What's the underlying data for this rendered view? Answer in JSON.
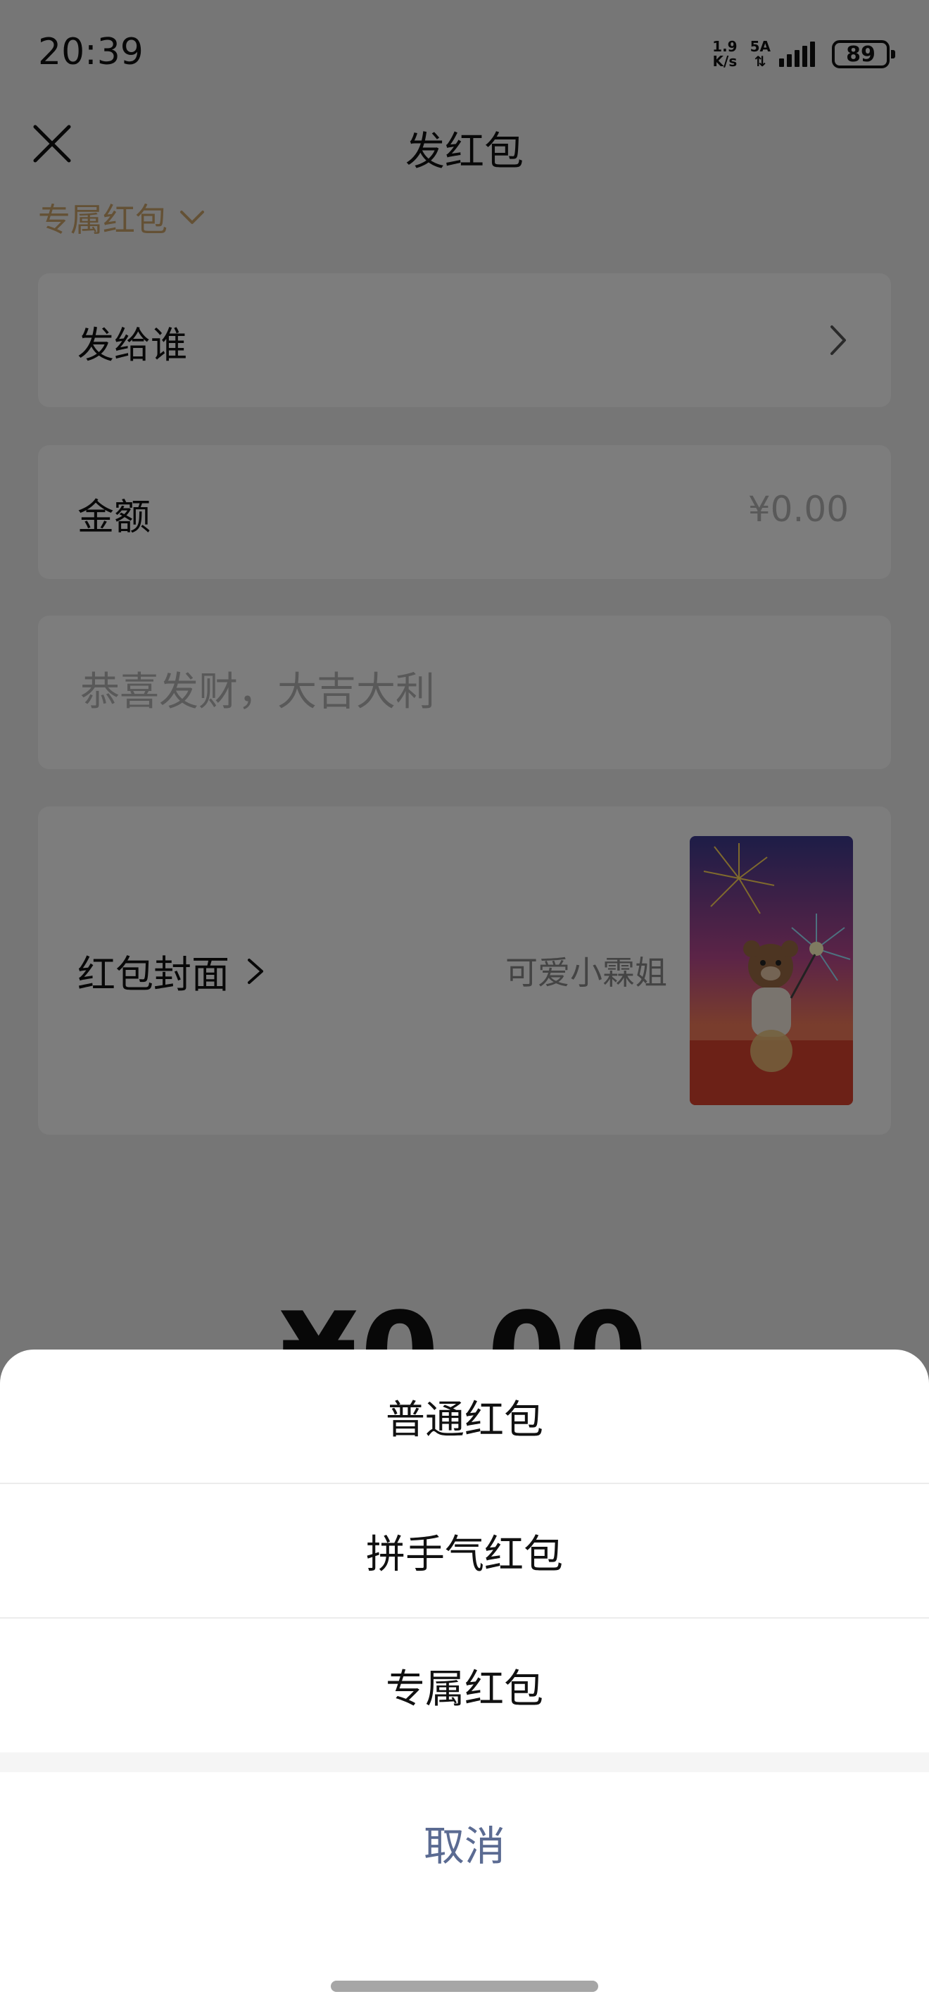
{
  "status_bar": {
    "time": "20:39",
    "net_speed_top": "1.9",
    "net_speed_bottom": "K/s",
    "network_top": "5A",
    "network_bottom": "⇅",
    "battery": "89"
  },
  "header": {
    "title": "发红包",
    "close_icon": "close-icon"
  },
  "type_selector": {
    "label": "专属红包",
    "icon": "chevron-down-icon",
    "color": "#c9a26b"
  },
  "form": {
    "recipient_label": "发给谁",
    "amount_label": "金额",
    "amount_value": "¥0.00",
    "message_placeholder": "恭喜发财，大吉大利",
    "message_value": "",
    "cover_label": "红包封面",
    "cover_name": "可爱小霖姐"
  },
  "total": {
    "amount": "¥0.00"
  },
  "action_sheet": {
    "options": [
      {
        "label": "普通红包"
      },
      {
        "label": "拼手气红包"
      },
      {
        "label": "专属红包"
      }
    ],
    "cancel_label": "取消",
    "cancel_color": "#5b6b92"
  }
}
